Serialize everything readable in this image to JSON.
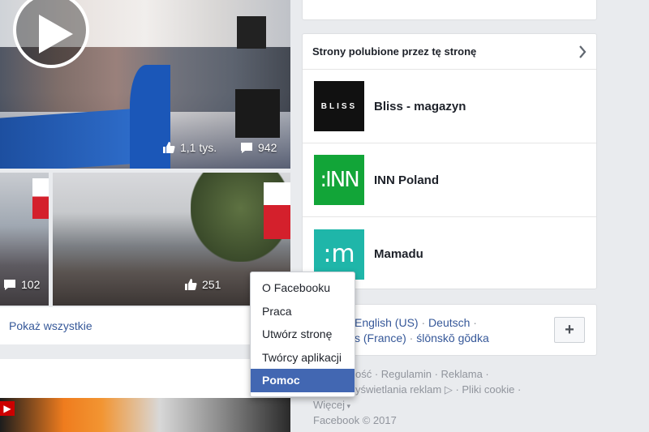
{
  "photos": {
    "top_video": {
      "likes": "1,1 tys.",
      "comments": "942"
    },
    "left_small": {
      "comments": "102"
    },
    "middle": {
      "likes": "251"
    }
  },
  "see_all": "Pokaż wszystkie",
  "liked_pages": {
    "title": "Strony polubione przez tę stronę",
    "items": [
      {
        "name": "Bliss - magazyn",
        "logo_text": "BLISS",
        "logo_bg": "#111111"
      },
      {
        "name": "INN Poland",
        "logo_text": ":INN",
        "logo_bg": "#12a538"
      },
      {
        "name": "Mamadu",
        "logo_text": ":m",
        "logo_bg": "#1fb6a9"
      }
    ]
  },
  "languages": {
    "line1": [
      "English (US)",
      "Deutsch"
    ],
    "line2_partial": "s (France)",
    "line2_item": "ślōnskŏ gŏdka",
    "plus_label": "+"
  },
  "footer": {
    "line1_partial": "ość",
    "line1_items": [
      "Regulamin",
      "Reklama"
    ],
    "line2_partial": "yświetlania reklam",
    "line2_item": "Pliki cookie",
    "more": "Więcej",
    "copyright": "Facebook © 2017"
  },
  "menu": {
    "items": [
      "O Facebooku",
      "Praca",
      "Utwórz stronę",
      "Twórcy aplikacji",
      "Pomoc"
    ],
    "active_index": 4
  },
  "colors": {
    "link": "#365899",
    "accent": "#4267b2"
  }
}
